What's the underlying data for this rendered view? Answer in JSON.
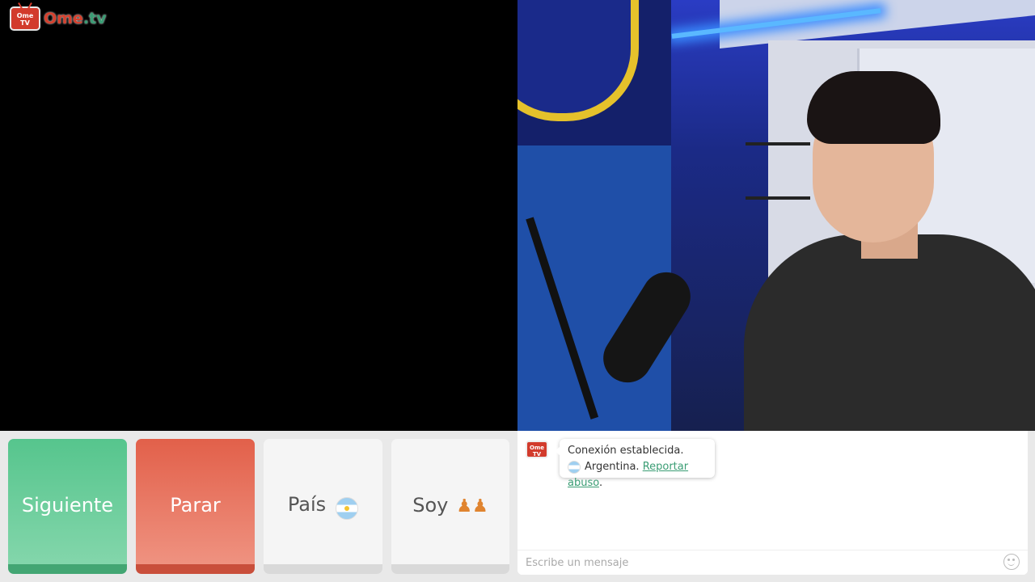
{
  "app": {
    "logo_text": "Ome",
    "logo_accent": ".tv",
    "logo_tv_label": "Ome TV"
  },
  "controls": {
    "next_label": "Siguiente",
    "stop_label": "Parar",
    "country_label": "País",
    "country_flag": "Argentina flag",
    "gender_label": "Soy",
    "gender_icon": "couple-icon"
  },
  "chat": {
    "system_message_line1": "Conexión establecida.",
    "country_name": "Argentina.",
    "report_link": "Reportar abuso",
    "report_suffix": ".",
    "input_placeholder": "Escribe un mensaje",
    "emoji_icon": "smiley-icon"
  },
  "colors": {
    "next": "#56c58d",
    "stop": "#e2604a",
    "brand_red": "#d23b2c",
    "link_green": "#3a9d74"
  }
}
